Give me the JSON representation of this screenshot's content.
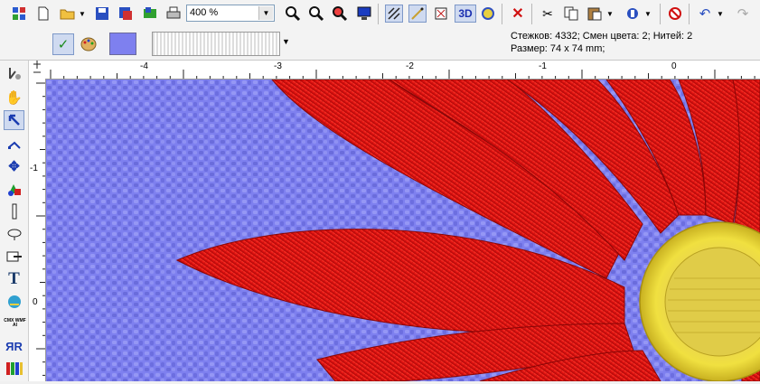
{
  "toolbar": {
    "zoom_value": "400 %",
    "three_d_label": "3D"
  },
  "status": {
    "line1": "Стежков:  4332;  Смен цвета:  2;  Нитей: 2",
    "line2": "Размер: 74 x 74 mm;"
  },
  "colors": {
    "fabric": "#7e80ef",
    "petal": "#e01010",
    "center": "#e8d832"
  },
  "ruler": {
    "h_labels": [
      "-4",
      "-3",
      "-2",
      "-1",
      "0"
    ],
    "v_labels": [
      "-1",
      "0"
    ]
  },
  "left_tools": {
    "text_tool_label": "T",
    "format_label": "CMX WMF AI",
    "font_label": "ЯR"
  }
}
